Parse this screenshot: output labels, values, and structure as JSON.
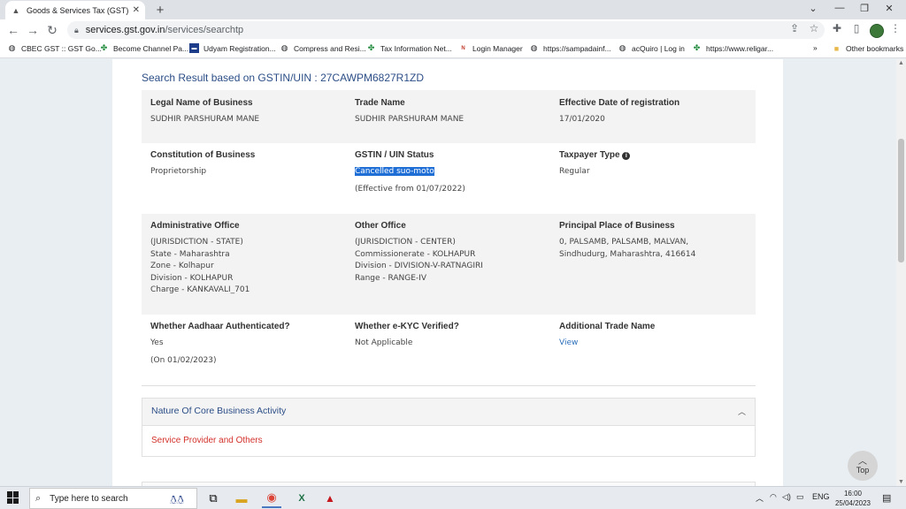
{
  "browser": {
    "tab_title": "Goods & Services Tax (GST) | Ser",
    "url_host": "services.gst.gov.in",
    "url_path": "/services/searchtp",
    "bookmarks": [
      {
        "label": "CBEC GST :: GST Go...",
        "icon": "globe-icon"
      },
      {
        "label": "Become Channel Pa...",
        "icon": "gst-icon"
      },
      {
        "label": "Udyam Registration...",
        "icon": "udyam-icon"
      },
      {
        "label": "Compress and Resi...",
        "icon": "globe-icon"
      },
      {
        "label": "Tax Information Net...",
        "icon": "gst-icon"
      },
      {
        "label": "Login Manager",
        "icon": "nsdl-icon"
      },
      {
        "label": "https://sampadainf...",
        "icon": "globe-icon"
      },
      {
        "label": "acQuiro | Log in",
        "icon": "globe-icon"
      },
      {
        "label": "https://www.religar...",
        "icon": "gst-icon"
      }
    ],
    "overflow_label": "»",
    "other_bookmarks": "Other bookmarks"
  },
  "page": {
    "search_title": "Search Result based on GSTIN/UIN : 27CAWPM6827R1ZD",
    "legal_name_label": "Legal Name of Business",
    "legal_name_value": "SUDHIR PARSHURAM MANE",
    "trade_name_label": "Trade Name",
    "trade_name_value": "SUDHIR PARSHURAM MANE",
    "eff_date_label": "Effective Date of registration",
    "eff_date_value": "17/01/2020",
    "constitution_label": "Constitution of Business",
    "constitution_value": "Proprietorship",
    "status_label": "GSTIN / UIN Status",
    "status_value": "Cancelled suo-moto",
    "status_effective": "(Effective from 01/07/2022)",
    "taxpayer_type_label": "Taxpayer Type",
    "taxpayer_type_value": "Regular",
    "admin_office_label": "Administrative Office",
    "admin_office_lines": [
      "(JURISDICTION - STATE)",
      "State - Maharashtra",
      "Zone - Kolhapur",
      "Division - KOLHAPUR",
      "Charge - KANKAVALI_701"
    ],
    "other_office_label": "Other Office",
    "other_office_lines": [
      "(JURISDICTION - CENTER)",
      "Commissionerate - KOLHAPUR",
      "Division - DIVISION-V-RATNAGIRI",
      "Range - RANGE-IV"
    ],
    "principal_place_label": "Principal Place of Business",
    "principal_place_lines": [
      "0, PALSAMB, PALSAMB, MALVAN,",
      "Sindhudurg, Maharashtra, 416614"
    ],
    "aadhaar_label": "Whether Aadhaar Authenticated?",
    "aadhaar_value": "Yes",
    "aadhaar_date": "(On 01/02/2023)",
    "ekyc_label": "Whether e-KYC Verified?",
    "ekyc_value": "Not Applicable",
    "additional_trade_label": "Additional Trade Name",
    "additional_trade_link": "View",
    "nature_title": "Nature Of Core Business Activity",
    "nature_value": "Service Provider and Others",
    "top_button": "Top"
  },
  "taskbar": {
    "search_placeholder": "Type here to search",
    "language": "ENG",
    "time": "16:00",
    "date": "25/04/2023"
  },
  "colors": {
    "title_blue": "#2c4e86",
    "highlight": "#1e6ed6",
    "red_text": "#d3312a",
    "link": "#2c6fbb"
  }
}
